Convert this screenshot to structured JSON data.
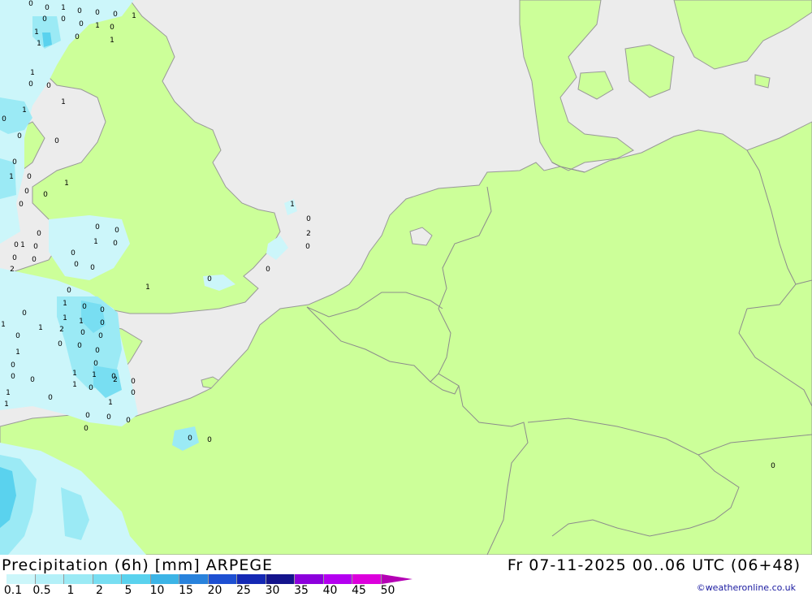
{
  "map": {
    "colors": {
      "sea": "#ececec",
      "land": "#ccff99",
      "border": "#8c8c8c",
      "coast": "#999999",
      "precip_light": "#ccf6fa",
      "precip_mid": "#9beaf5",
      "precip_heavy": "#5ad2ee"
    },
    "point_values": [
      {
        "v": "0"
      },
      {
        "v": "0"
      },
      {
        "v": "1"
      },
      {
        "v": "0"
      },
      {
        "v": "0"
      },
      {
        "v": "0"
      },
      {
        "v": "1"
      },
      {
        "v": "0"
      },
      {
        "v": "1"
      },
      {
        "v": "0"
      },
      {
        "v": "1"
      },
      {
        "v": "0"
      },
      {
        "v": "0"
      },
      {
        "v": "1"
      },
      {
        "v": "0"
      },
      {
        "v": "1"
      },
      {
        "v": "1"
      },
      {
        "v": "0"
      },
      {
        "v": "0"
      },
      {
        "v": "1"
      },
      {
        "v": "0"
      },
      {
        "v": "0"
      },
      {
        "v": "1"
      },
      {
        "v": "0"
      },
      {
        "v": "0"
      },
      {
        "v": "0"
      },
      {
        "v": "1"
      },
      {
        "v": "0"
      },
      {
        "v": "1"
      },
      {
        "v": "0"
      },
      {
        "v": "0"
      },
      {
        "v": "0"
      },
      {
        "v": "1"
      },
      {
        "v": "0"
      },
      {
        "v": "0"
      },
      {
        "v": "0"
      },
      {
        "v": "0"
      },
      {
        "v": "0"
      },
      {
        "v": "0"
      },
      {
        "v": "0"
      },
      {
        "v": "1"
      },
      {
        "v": "0"
      },
      {
        "v": "0"
      },
      {
        "v": "0"
      },
      {
        "v": "2"
      },
      {
        "v": "1"
      },
      {
        "v": "0"
      },
      {
        "v": "0"
      },
      {
        "v": "1"
      },
      {
        "v": "0"
      },
      {
        "v": "2"
      },
      {
        "v": "0"
      },
      {
        "v": "0"
      },
      {
        "v": "1"
      },
      {
        "v": "0"
      },
      {
        "v": "0"
      },
      {
        "v": "1"
      },
      {
        "v": "1"
      },
      {
        "v": "0"
      },
      {
        "v": "1"
      },
      {
        "v": "2"
      },
      {
        "v": "0"
      },
      {
        "v": "0"
      },
      {
        "v": "0"
      },
      {
        "v": "1"
      },
      {
        "v": "0"
      },
      {
        "v": "1"
      },
      {
        "v": "0"
      },
      {
        "v": "0"
      },
      {
        "v": "0"
      },
      {
        "v": "0"
      },
      {
        "v": "0"
      },
      {
        "v": "0"
      },
      {
        "v": "0"
      },
      {
        "v": "1"
      },
      {
        "v": "1"
      },
      {
        "v": "0"
      },
      {
        "v": "0"
      },
      {
        "v": "2"
      },
      {
        "v": "1"
      },
      {
        "v": "0"
      },
      {
        "v": "0"
      },
      {
        "v": "1"
      },
      {
        "v": "0"
      },
      {
        "v": "1"
      },
      {
        "v": "1"
      },
      {
        "v": "0"
      },
      {
        "v": "0"
      },
      {
        "v": "0"
      },
      {
        "v": "0"
      },
      {
        "v": "0"
      },
      {
        "v": "0"
      },
      {
        "v": "0"
      }
    ]
  },
  "footer": {
    "title": "Precipitation (6h) [mm] ARPEGE",
    "valid_time": "Fr 07-11-2025 00..06 UTC (06+48)",
    "credit": "©weatheronline.co.uk",
    "legend": [
      {
        "label": "0.1",
        "color": "#ccf6fa"
      },
      {
        "label": "0.5",
        "color": "#b4f0f8"
      },
      {
        "label": "1",
        "color": "#9beaf5"
      },
      {
        "label": "2",
        "color": "#78def2"
      },
      {
        "label": "5",
        "color": "#5ad2ee"
      },
      {
        "label": "10",
        "color": "#3cb4e6"
      },
      {
        "label": "15",
        "color": "#2882dc"
      },
      {
        "label": "20",
        "color": "#1e50d2"
      },
      {
        "label": "25",
        "color": "#1428b4"
      },
      {
        "label": "30",
        "color": "#14148c"
      },
      {
        "label": "35",
        "color": "#8c00dc"
      },
      {
        "label": "40",
        "color": "#b400f0"
      },
      {
        "label": "45",
        "color": "#dc00dc"
      },
      {
        "label": "50",
        "color": "#b400b4"
      }
    ]
  }
}
